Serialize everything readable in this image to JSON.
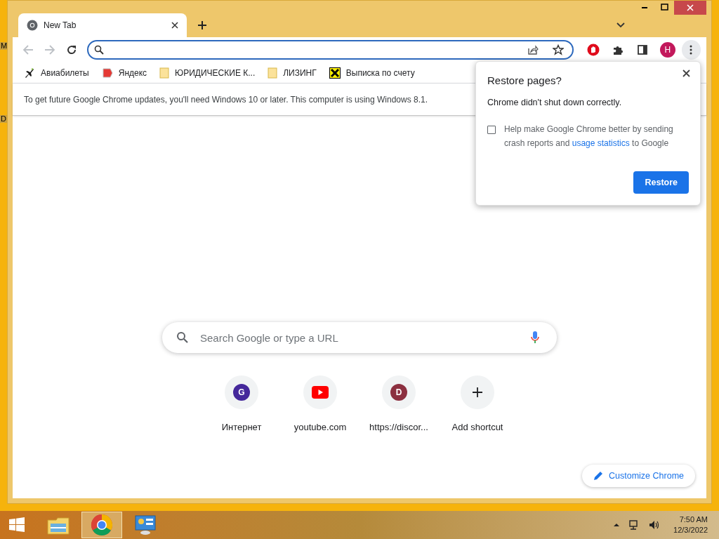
{
  "desktop_labels": [
    "M",
    "D"
  ],
  "tabs": [
    {
      "title": "New Tab",
      "selected": true
    }
  ],
  "toolbar": {
    "profile_initial": "H"
  },
  "bookmarks": [
    {
      "kind": "plane",
      "label": "Авиабилеты"
    },
    {
      "kind": "yandex",
      "label": "Яндекс"
    },
    {
      "kind": "folder",
      "label": "ЮРИДИЧЕСКИЕ К..."
    },
    {
      "kind": "folder",
      "label": "ЛИЗИНГ"
    },
    {
      "kind": "bank",
      "label": "Выписка по счету"
    }
  ],
  "info_bar": "To get future Google Chrome updates, you'll need Windows 10 or later. This computer is using Windows 8.1.",
  "restore_dialog": {
    "title": "Restore pages?",
    "message": "Chrome didn't shut down correctly.",
    "checkbox": {
      "checked": false,
      "text_before": "Help make Google Chrome better by sending crash reports and",
      "link": "usage statistics",
      "text_after": "to Google"
    },
    "button": "Restore"
  },
  "search": {
    "placeholder": "Search Google or type a URL"
  },
  "shortcuts": [
    {
      "kind": "letter",
      "letter": "G",
      "color": "#45289b",
      "label": "Интернет"
    },
    {
      "kind": "youtube",
      "label": "youtube.com"
    },
    {
      "kind": "letter",
      "letter": "D",
      "color": "#8c3040",
      "label": "https://discor..."
    },
    {
      "kind": "add",
      "label": "Add shortcut"
    }
  ],
  "customize_button": "Customize Chrome",
  "taskbar": {
    "apps": [
      {
        "kind": "explorer",
        "selected": false
      },
      {
        "kind": "chrome",
        "selected": true
      },
      {
        "kind": "control-panel",
        "selected": false
      }
    ],
    "time": "7:50 AM",
    "date": "12/3/2022"
  }
}
